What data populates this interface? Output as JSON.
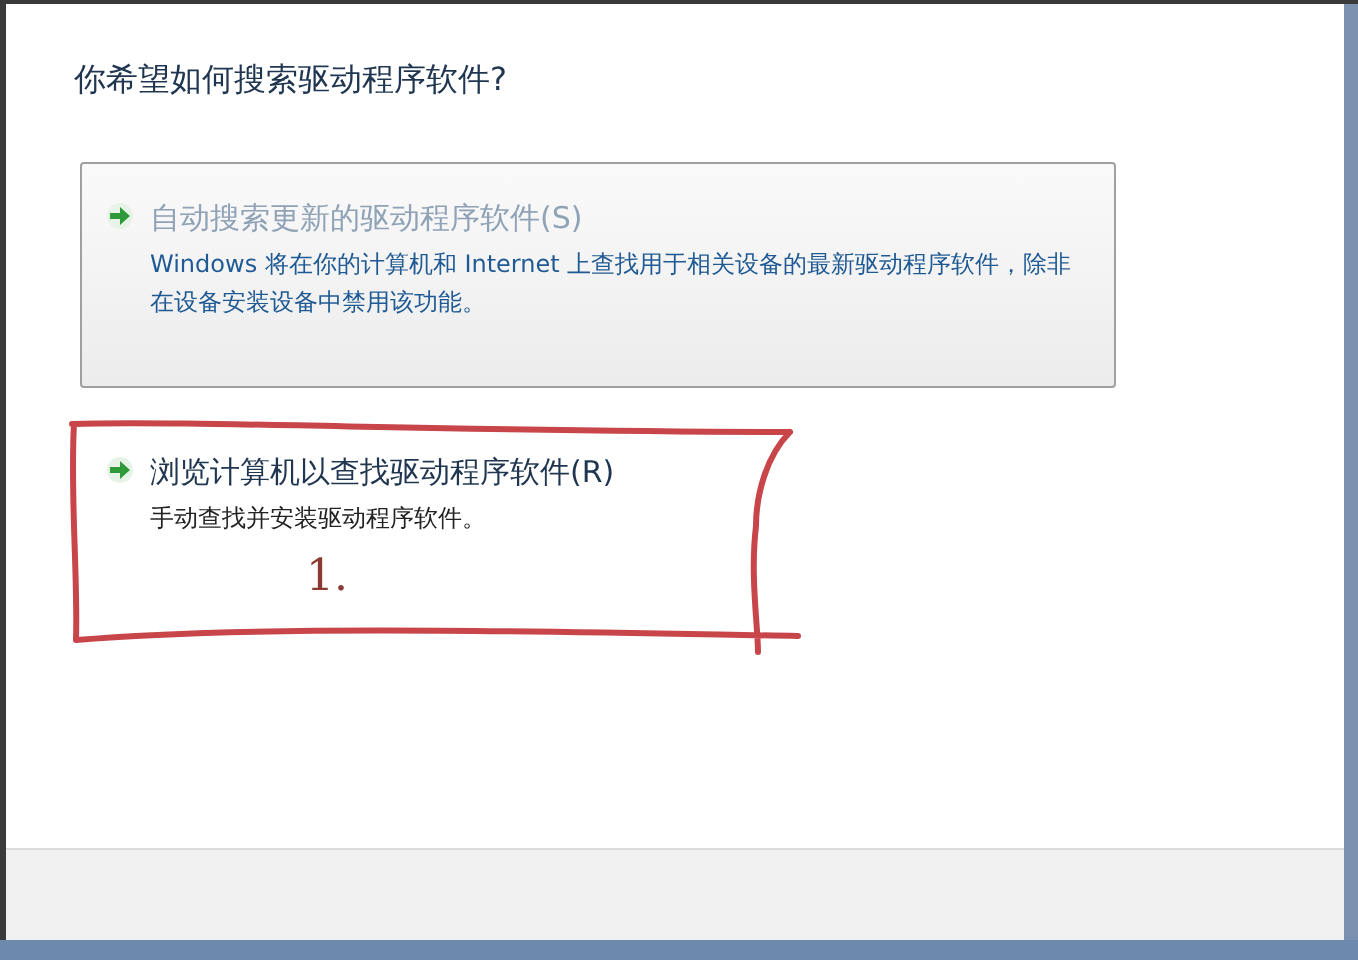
{
  "heading": "你希望如何搜索驱动程序软件?",
  "options": [
    {
      "title": "自动搜索更新的驱动程序软件(S)",
      "description": "Windows 将在你的计算机和 Internet 上查找用于相关设备的最新驱动程序软件，除非在设备安装设备中禁用该功能。",
      "selected": true
    },
    {
      "title": "浏览计算机以查找驱动程序软件(R)",
      "description": "手动查找并安装驱动程序软件。",
      "selected": false
    }
  ],
  "annotation": {
    "label": "1."
  }
}
